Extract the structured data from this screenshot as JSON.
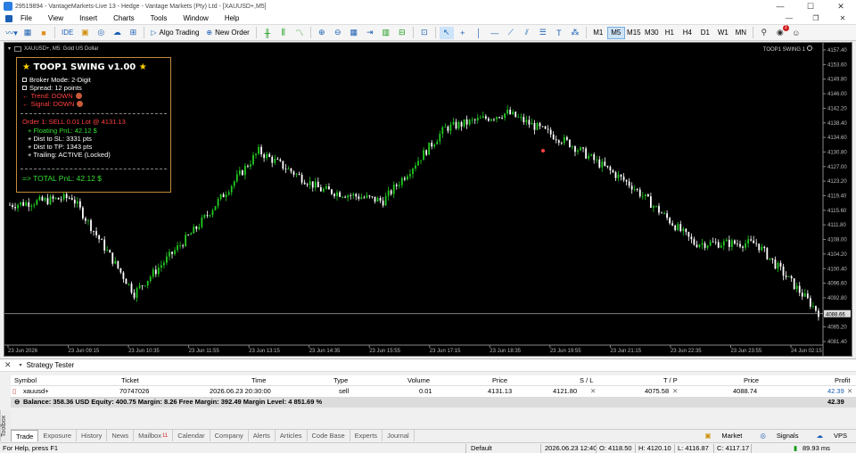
{
  "window": {
    "title": "29519894 - VantageMarkets-Live 13 - Hedge - Vantage Markets (Pty) Ltd - [XAUUSD+,M5]",
    "min": "—",
    "max": "☐",
    "close": "✕"
  },
  "menu": [
    "File",
    "View",
    "Insert",
    "Charts",
    "Tools",
    "Window",
    "Help"
  ],
  "menu_right": [
    "—",
    "❐",
    "✕"
  ],
  "toolbar": {
    "ide": "IDE",
    "algo": "Algo Trading",
    "new_order": "New Order",
    "timeframes": [
      "M1",
      "M5",
      "M15",
      "M30",
      "H1",
      "H4",
      "D1",
      "W1",
      "MN"
    ],
    "active_tf": "M5",
    "notif_count": "1"
  },
  "chart": {
    "symbol_label": "XAUUSD+, M5:  Gold US Dollar",
    "ea_label": "TOOP1 SWING 1",
    "current_price": "4088.66",
    "price_ticks": [
      "4157.40",
      "4153.60",
      "4149.80",
      "4146.00",
      "4142.20",
      "4138.40",
      "4134.60",
      "4130.80",
      "4127.00",
      "4123.20",
      "4119.40",
      "4115.60",
      "4111.80",
      "4108.00",
      "4104.20",
      "4100.40",
      "4096.60",
      "4092.80",
      "4085.20",
      "4081.40"
    ],
    "time_ticks": [
      "23 Jun 2026",
      "23 Jun 09:15",
      "23 Jun 10:35",
      "23 Jun 11:55",
      "23 Jun 13:15",
      "23 Jun 14:35",
      "23 Jun 15:55",
      "23 Jun 17:15",
      "23 Jun 18:35",
      "23 Jun 19:55",
      "23 Jun 21:15",
      "23 Jun 22:35",
      "23 Jun 23:55",
      "24 Jun 02:15"
    ],
    "colors": {
      "up": "#22cc22",
      "down": "#ffffff",
      "bg": "#000000"
    }
  },
  "chart_data": {
    "type": "line",
    "title": "XAUUSD+, M5",
    "ylim": [
      4081.4,
      4157.4
    ],
    "ylabel": "",
    "x": [
      "23 Jun 2026",
      "23 Jun 09:15",
      "23 Jun 10:35",
      "23 Jun 11:55",
      "23 Jun 13:15",
      "23 Jun 14:35",
      "23 Jun 15:55",
      "23 Jun 17:15",
      "23 Jun 18:35",
      "23 Jun 19:55",
      "23 Jun 21:15",
      "23 Jun 22:35",
      "23 Jun 23:55",
      "24 Jun 02:15"
    ],
    "series": [
      {
        "name": "XAUUSD+",
        "values": [
          4117,
          4119,
          4094,
          4111,
          4131,
          4121,
          4118,
          4137,
          4141,
          4133,
          4122,
          4107,
          4107,
          4089
        ]
      }
    ],
    "grid": false
  },
  "panel": {
    "title": "TOOP1 SWING v1.00",
    "broker_mode": "Broker Mode:  2-Digit",
    "spread": "Spread:  12 points",
    "trend": "Trend:  DOWN",
    "signal": "Signal:  DOWN",
    "order": "Order 1: SELL 0.01 Lot @ 4131.13",
    "floating": "+ Floating PnL:  42.12 $",
    "dist_sl": "+ Dist to SL:  3331 pts",
    "dist_tp": "+ Dist to TP:  1343 pts",
    "trailing": "+ Trailing:  ACTIVE (Locked)",
    "total": "=> TOTAL PnL:  42.12 $"
  },
  "strategy_tester": {
    "label": "Strategy Tester",
    "close": "✕",
    "arrow": "▾"
  },
  "table": {
    "headers": [
      "Symbol",
      "Ticket",
      "Time",
      "Type",
      "Volume",
      "Price",
      "S / L",
      "T / P",
      "Price",
      "Profit"
    ],
    "rows": [
      {
        "symbol": "xauusd+",
        "ticket": "70747026",
        "time": "2026.06.23 20:30:00",
        "type": "sell",
        "volume": "0.01",
        "price": "4131.13",
        "sl": "4121.80",
        "tp": "4075.58",
        "cur": "4088.74",
        "profit": "42.39",
        "x": "✕"
      }
    ],
    "balance": "Balance: 358.36 USD  Equity: 400.75  Margin: 8.26  Free Margin: 392.49  Margin Level: 4 851.69 %",
    "balance_profit": "42.39"
  },
  "toolbox": "Toolbox",
  "tabs": [
    "Trade",
    "Exposure",
    "History",
    "News",
    "Mailbox",
    "Calendar",
    "Company",
    "Alerts",
    "Articles",
    "Code Base",
    "Experts",
    "Journal"
  ],
  "mailbox_badge": "11",
  "tabs_right": [
    "Market",
    "Signals",
    "VPS"
  ],
  "status": {
    "help": "For Help, press F1",
    "profile": "Default",
    "datetime": "2026.06.23 12:40",
    "open": "O: 4118.50",
    "high": "H: 4120.10",
    "low": "L: 4116.87",
    "close": "C: 4117.17",
    "ping": "89.93 ms"
  }
}
